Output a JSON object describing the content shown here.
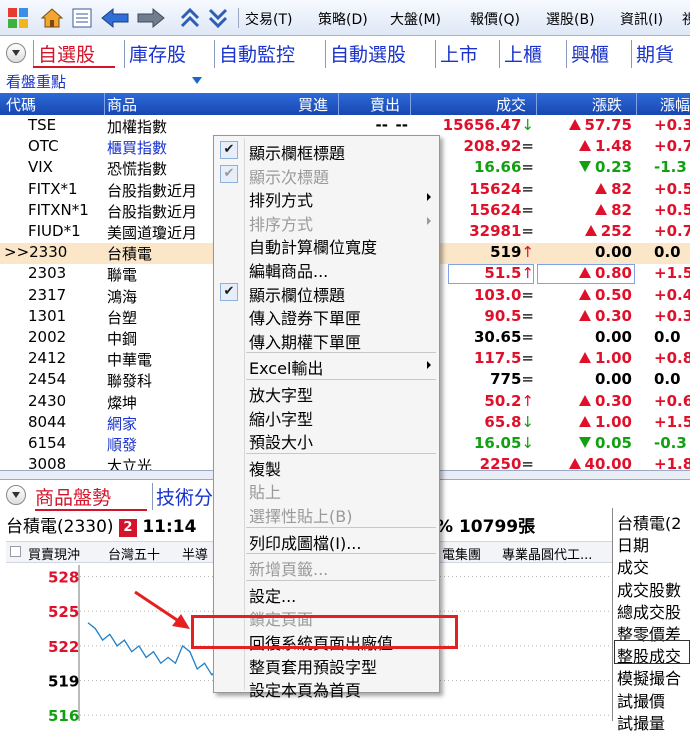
{
  "toolbar": {
    "menus": [
      "交易(T)",
      "策略(D)",
      "大盤(M)",
      "報價(Q)",
      "選股(B)",
      "資訊(I)",
      "視"
    ],
    "icons": [
      "grid-icon",
      "home-icon",
      "doc-icon",
      "back-arrow-icon",
      "forward-arrow-icon",
      "up-chevron-icon",
      "down-chevron-icon"
    ]
  },
  "tabs": [
    "自選股",
    "庫存股",
    "自動監控",
    "自動選股",
    "上市",
    "上櫃",
    "興櫃",
    "期貨"
  ],
  "sub_label": "看盤重點",
  "columns": [
    "代碼",
    "商品",
    "買進",
    "賣出",
    "成交",
    "漲跌",
    "漲幅"
  ],
  "rows": [
    {
      "code": "TSE",
      "name": "加權指數",
      "bid": "--",
      "ask": "--",
      "price": "15656.47",
      "pmark": "↓",
      "pcolor": "red",
      "chg": "57.75",
      "dir": "up",
      "pct": "+0.3"
    },
    {
      "code": "OTC",
      "name": "櫃買指數",
      "name_blue": true,
      "bid": "",
      "ask": "",
      "price": "208.92",
      "pmark": "=",
      "pcolor": "red",
      "chg": "1.48",
      "dir": "up",
      "pct": "+0.7"
    },
    {
      "code": "VIX",
      "name": "恐慌指數",
      "bid": "",
      "ask": "",
      "price": "16.66",
      "pmark": "=",
      "pcolor": "green",
      "chg": "0.23",
      "dir": "down",
      "pct": "-1.3"
    },
    {
      "code": "FITX*1",
      "name": "台股指數近月",
      "bid": "",
      "ask": "",
      "price": "15624",
      "pmark": "=",
      "pcolor": "red",
      "chg": "82",
      "dir": "up",
      "pct": "+0.5"
    },
    {
      "code": "FITXN*1",
      "name": "台股指數近月",
      "bid": "",
      "ask": "",
      "price": "15624",
      "pmark": "=",
      "pcolor": "red",
      "chg": "82",
      "dir": "up",
      "pct": "+0.5"
    },
    {
      "code": "FIUD*1",
      "name": "美國道瓊近月",
      "bid": "",
      "ask": "",
      "price": "32981",
      "pmark": "=",
      "pcolor": "red",
      "chg": "252",
      "dir": "up",
      "pct": "+0.7"
    },
    {
      "code": ">>2330",
      "name": "台積電",
      "bid": "",
      "ask": "",
      "price": "519",
      "pmark": "↑",
      "pcolor": "blk",
      "chg": "0.00",
      "dir": "none",
      "pct": "0.0"
    },
    {
      "code": "2303",
      "name": "聯電",
      "bid": "",
      "ask": "",
      "price": "51.5",
      "pmark": "↑",
      "pcolor": "red",
      "chg": "0.80",
      "dir": "up",
      "pct": "+1.5"
    },
    {
      "code": "2317",
      "name": "鴻海",
      "bid": "",
      "ask": "",
      "price": "103.0",
      "pmark": "=",
      "pcolor": "red",
      "chg": "0.50",
      "dir": "up",
      "pct": "+0.4"
    },
    {
      "code": "1301",
      "name": "台塑",
      "bid": "",
      "ask": "",
      "price": "90.5",
      "pmark": "=",
      "pcolor": "red",
      "chg": "0.30",
      "dir": "up",
      "pct": "+0.3"
    },
    {
      "code": "2002",
      "name": "中鋼",
      "bid": "",
      "ask": "",
      "price": "30.65",
      "pmark": "=",
      "pcolor": "blk",
      "chg": "0.00",
      "dir": "none",
      "pct": "0.0"
    },
    {
      "code": "2412",
      "name": "中華電",
      "bid": "",
      "ask": "",
      "price": "117.5",
      "pmark": "=",
      "pcolor": "red",
      "chg": "1.00",
      "dir": "up",
      "pct": "+0.8"
    },
    {
      "code": "2454",
      "name": "聯發科",
      "bid": "",
      "ask": "",
      "price": "775",
      "pmark": "=",
      "pcolor": "blk",
      "chg": "0.00",
      "dir": "none",
      "pct": "0.0"
    },
    {
      "code": "2430",
      "name": "燦坤",
      "bid": "",
      "ask": "",
      "price": "50.2",
      "pmark": "↑",
      "pcolor": "red",
      "chg": "0.30",
      "dir": "up",
      "pct": "+0.6"
    },
    {
      "code": "8044",
      "name": "網家",
      "name_blue": true,
      "bid": "",
      "ask": "",
      "price": "65.8",
      "pmark": "↓",
      "pcolor": "red",
      "chg": "1.00",
      "dir": "up",
      "pct": "+1.5"
    },
    {
      "code": "6154",
      "name": "順發",
      "name_blue": true,
      "bid": "",
      "ask": "",
      "price": "16.05",
      "pmark": "↓",
      "pcolor": "green",
      "chg": "0.05",
      "dir": "down",
      "pct": "-0.3"
    },
    {
      "code": "3008",
      "name": "大立光",
      "bid": "",
      "ask": "",
      "price": "2250",
      "pmark": "=",
      "pcolor": "red",
      "chg": "40.00",
      "dir": "up",
      "pct": "+1.8"
    }
  ],
  "context_menu": [
    {
      "label": "顯示欄框標題",
      "checked": true,
      "disabled": false,
      "submenu": false
    },
    {
      "label": "顯示次標題",
      "checked": true,
      "disabled": true,
      "submenu": false
    },
    {
      "label": "排列方式",
      "checked": false,
      "disabled": false,
      "submenu": true
    },
    {
      "label": "排序方式",
      "checked": false,
      "disabled": true,
      "submenu": true
    },
    {
      "label": "自動計算欄位寬度",
      "checked": false,
      "disabled": false,
      "submenu": false
    },
    {
      "label": "編輯商品...",
      "checked": false,
      "disabled": false,
      "submenu": false
    },
    {
      "label": "顯示欄位標題",
      "checked": true,
      "disabled": false,
      "submenu": false
    },
    {
      "label": "傳入證券下單匣",
      "checked": false,
      "disabled": false,
      "submenu": false
    },
    {
      "label": "傳入期權下單匣",
      "checked": false,
      "disabled": false,
      "submenu": false
    },
    {
      "sep": true
    },
    {
      "label": "Excel輸出",
      "checked": false,
      "disabled": false,
      "submenu": true
    },
    {
      "sep": true
    },
    {
      "label": "放大字型",
      "checked": false,
      "disabled": false,
      "submenu": false
    },
    {
      "label": "縮小字型",
      "checked": false,
      "disabled": false,
      "submenu": false
    },
    {
      "label": "預設大小",
      "checked": false,
      "disabled": false,
      "submenu": false
    },
    {
      "sep": true
    },
    {
      "label": "複製",
      "checked": false,
      "disabled": false,
      "submenu": false
    },
    {
      "label": "貼上",
      "checked": false,
      "disabled": true,
      "submenu": false
    },
    {
      "label": "選擇性貼上(B)",
      "checked": false,
      "disabled": true,
      "submenu": false
    },
    {
      "sep": true
    },
    {
      "label": "列印成圖檔(I)...",
      "checked": false,
      "disabled": false,
      "submenu": false
    },
    {
      "sep": true
    },
    {
      "label": "新增頁籤...",
      "checked": false,
      "disabled": true,
      "submenu": false
    },
    {
      "sep": true
    },
    {
      "label": "設定...",
      "checked": false,
      "disabled": false,
      "submenu": false
    },
    {
      "label": "鎖定頁面",
      "checked": false,
      "disabled": true,
      "submenu": false
    },
    {
      "label": "回復系統頁面出廠值",
      "checked": false,
      "disabled": false,
      "submenu": false
    },
    {
      "label": "整頁套用預設字型",
      "checked": false,
      "disabled": false,
      "submenu": false
    },
    {
      "label": "設定本頁為首頁",
      "checked": false,
      "disabled": false,
      "submenu": false
    }
  ],
  "lower": {
    "tabs": [
      "商品盤勢",
      "技術分"
    ],
    "stock_name": "台積電(2330)",
    "badge": "2",
    "time": "11:14",
    "volume": "% 10799張",
    "filters_left": [
      "買賣現沖",
      "台灣五十",
      "半導"
    ],
    "filters_right": [
      "電集團",
      "專業晶圓代工..."
    ],
    "y_labels": [
      "528",
      "525",
      "522",
      "519",
      "516"
    ],
    "right_panel": [
      "台積電(2",
      "日期",
      "成交",
      "成交股數",
      "總成交股",
      "整零價差",
      "整股成交",
      "模擬撮合",
      "試撮價",
      "試撮量"
    ]
  },
  "chart_data": {
    "type": "line",
    "y_ticks": [
      528,
      525,
      522,
      519,
      516
    ],
    "ylim": [
      515.5,
      529
    ],
    "y": [
      524.0,
      523.5,
      522.5,
      523.0,
      522.0,
      522.5,
      521.5,
      522.0,
      521.0,
      521.5,
      520.5,
      521.0,
      520.5,
      522.0,
      521.5,
      520.0,
      520.5,
      519.5,
      520.0,
      519.0,
      519.5,
      518.5,
      519.0,
      518.0,
      518.5,
      518.0
    ]
  },
  "colors": {
    "up": "#e0102a",
    "down": "#12a012",
    "header": "#1847b0",
    "tab_active": "#d4142a",
    "tab": "#1a33cc",
    "highlight": "#e42020"
  }
}
